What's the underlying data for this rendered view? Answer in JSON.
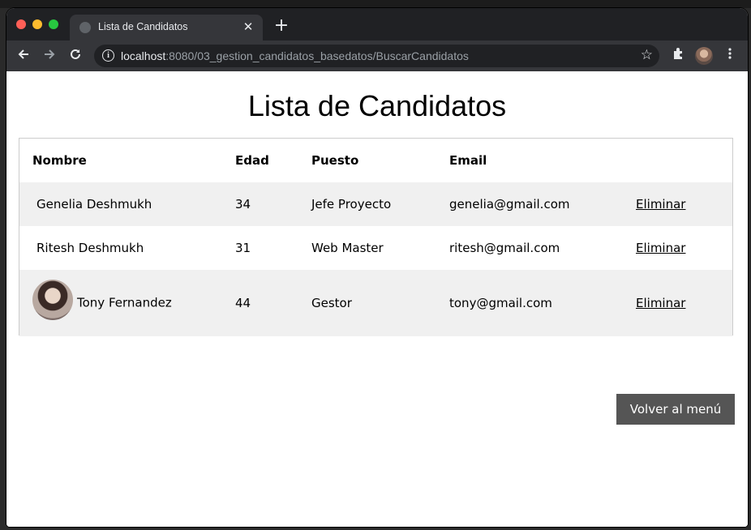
{
  "browser": {
    "tab_title": "Lista de Candidatos",
    "tab_close": "✕",
    "new_tab": "+",
    "url_host": "localhost",
    "url_rest": ":8080/03_gestion_candidatos_basedatos/BuscarCandidatos",
    "icons": [
      "back-icon",
      "forward-icon",
      "reload-icon",
      "info-icon",
      "star-icon",
      "extensions-icon",
      "profile-avatar",
      "menu-icon"
    ]
  },
  "page": {
    "title": "Lista de Candidatos",
    "table": {
      "headers": [
        "Nombre",
        "Edad",
        "Puesto",
        "Email",
        ""
      ],
      "rows": [
        {
          "nombre": "Genelia Deshmukh",
          "edad": "34",
          "puesto": "Jefe Proyecto",
          "email": "genelia@gmail.com",
          "accion": "Eliminar"
        },
        {
          "nombre": "Ritesh Deshmukh",
          "edad": "31",
          "puesto": "Web Master",
          "email": "ritesh@gmail.com",
          "accion": "Eliminar"
        },
        {
          "nombre": "Tony Fernandez",
          "edad": "44",
          "puesto": "Gestor",
          "email": "tony@gmail.com",
          "accion": "Eliminar"
        }
      ]
    },
    "back_button": "Volver al menú"
  },
  "colors": {
    "row_alt": "#f0f0f0",
    "button_bg": "#555555",
    "chrome_dark": "#202124",
    "chrome_tab": "#35363a"
  }
}
